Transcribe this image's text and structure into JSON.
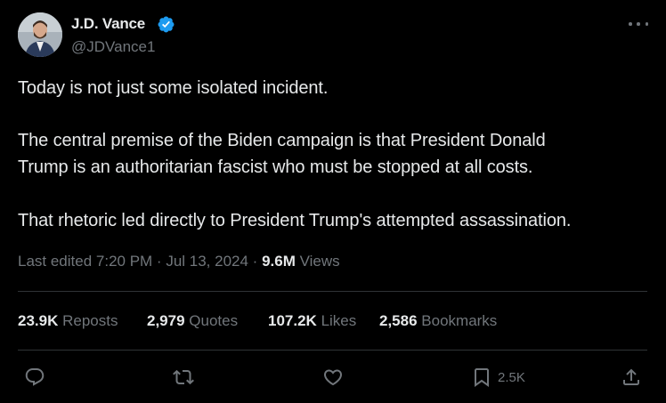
{
  "author": {
    "name": "J.D. Vance",
    "handle": "@JDVance1",
    "verified_color": "#1d9bf0"
  },
  "tweet": {
    "lines": [
      "Today is not just some isolated incident.",
      "The central premise of the Biden campaign is that President Donald",
      "Trump is an authoritarian fascist who must be stopped at all costs.",
      "That rhetoric led directly to President Trump's attempted assassination."
    ]
  },
  "meta": {
    "edited": "Last edited 7:20 PM · Jul 13, 2024 ·",
    "views_count": "9.6M",
    "views_label": "Views"
  },
  "stats": {
    "reposts_count": "23.9K",
    "reposts_label": "Reposts",
    "quotes_count": "2,979",
    "quotes_label": "Quotes",
    "likes_count": "107.2K",
    "likes_label": "Likes",
    "bookmarks_count": "2,586",
    "bookmarks_label": "Bookmarks"
  },
  "actions": {
    "reply_icon": "reply-icon",
    "repost_icon": "repost-icon",
    "like_icon": "heart-icon",
    "bookmark_icon": "bookmark-icon",
    "bookmark_count": "2.5K",
    "share_icon": "share-icon"
  }
}
